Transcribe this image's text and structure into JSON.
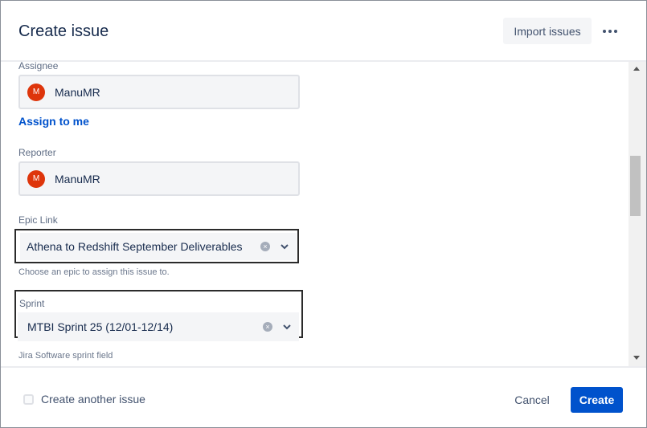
{
  "header": {
    "title": "Create issue",
    "import_label": "Import issues",
    "more_icon": "more-horizontal-icon"
  },
  "fields": {
    "assignee": {
      "label": "Assignee",
      "avatar_initial": "M",
      "value": "ManuMR",
      "assign_link": "Assign to me"
    },
    "reporter": {
      "label": "Reporter",
      "avatar_initial": "M",
      "value": "ManuMR"
    },
    "epic_link": {
      "label": "Epic Link",
      "value": "Athena to Redshift September Deliverables",
      "help": "Choose an epic to assign this issue to."
    },
    "sprint": {
      "label": "Sprint",
      "value": "MTBI Sprint 25 (12/01-12/14)",
      "help": "Jira Software sprint field"
    }
  },
  "footer": {
    "create_another_label": "Create another issue",
    "create_another_checked": false,
    "cancel_label": "Cancel",
    "create_label": "Create"
  },
  "colors": {
    "primary": "#0052cc",
    "avatar": "#de350b",
    "field_bg": "#f4f5f7"
  }
}
